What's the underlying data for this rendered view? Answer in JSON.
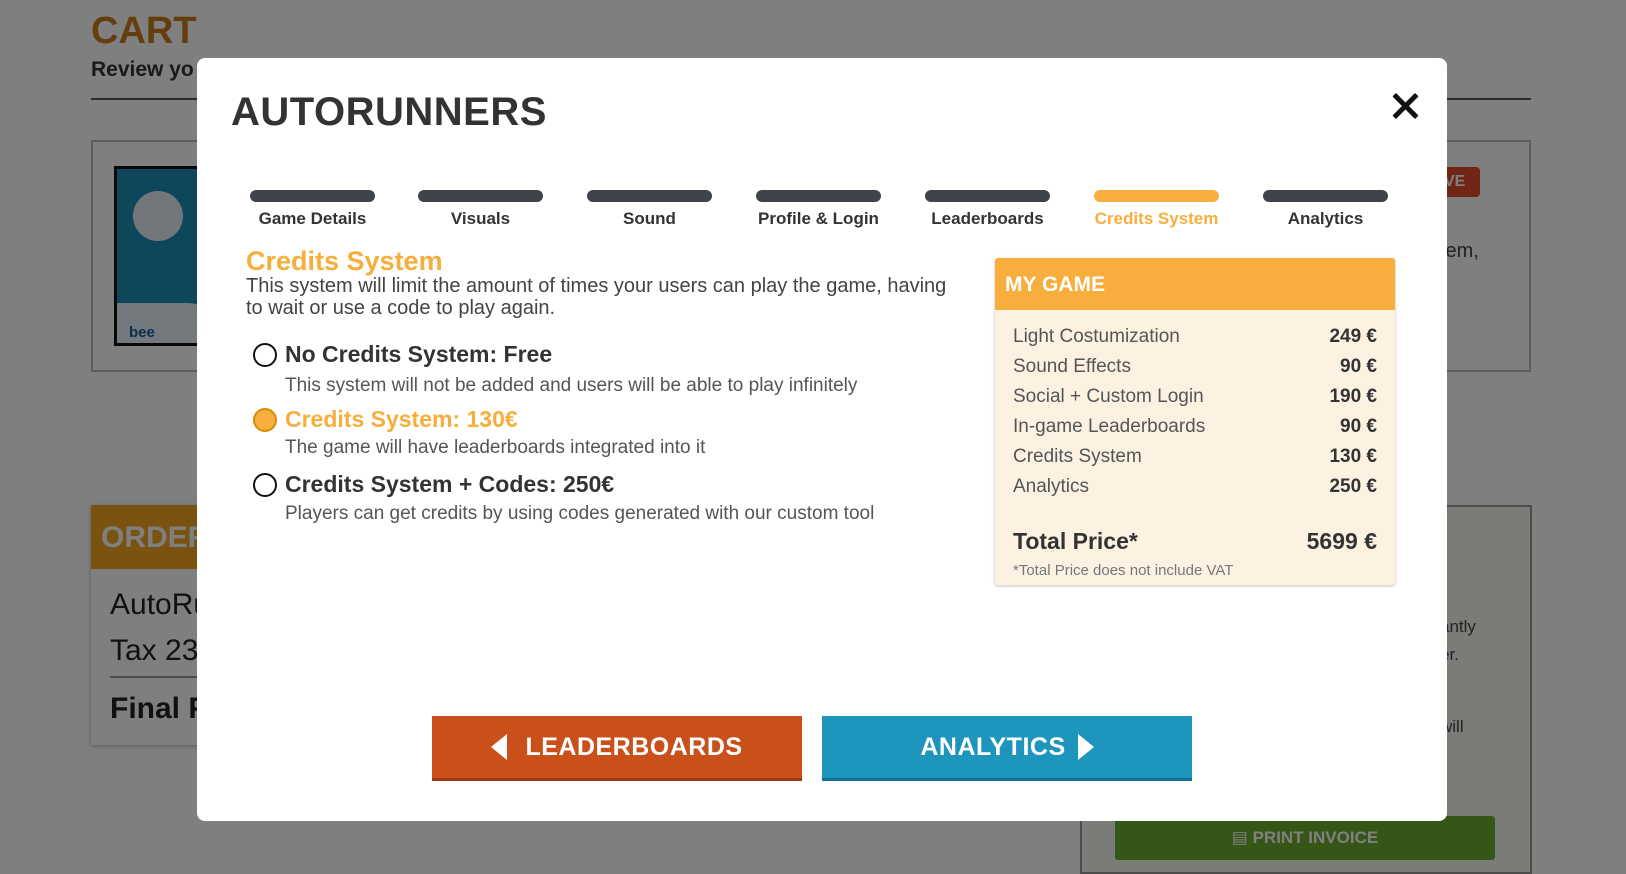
{
  "background": {
    "cart_title": "CART",
    "cart_subtitle": "Review yo",
    "thumb_brand": "bee",
    "badge_fragment": "VE",
    "right_fragment_1": "tem,",
    "order_title": "ORDER",
    "order_line_1": "AutoRu",
    "order_line_2": "Tax 23",
    "order_final": "Final P",
    "right_fragment_2": "antly",
    "right_fragment_3": "er.",
    "right_fragment_4": "will",
    "print_invoice": "PRINT INVOICE"
  },
  "modal": {
    "title": "AUTORUNNERS",
    "close_icon": "close-icon",
    "steps": [
      {
        "label": "Game Details",
        "active": false
      },
      {
        "label": "Visuals",
        "active": false
      },
      {
        "label": "Sound",
        "active": false
      },
      {
        "label": "Profile & Login",
        "active": false
      },
      {
        "label": "Leaderboards",
        "active": false
      },
      {
        "label": "Credits System",
        "active": true
      },
      {
        "label": "Analytics",
        "active": false
      }
    ],
    "section": {
      "title": "Credits System",
      "description": "This system will limit the amount of times your users can play the game, having to wait or use a code to play again."
    },
    "options": [
      {
        "label": "No Credits System: Free",
        "description": "This system will not be added and users will be able to play infinitely",
        "selected": false
      },
      {
        "label": "Credits System: 130€",
        "description": "The game will have leaderboards integrated into it",
        "selected": true
      },
      {
        "label": "Credits System + Codes: 250€",
        "description": "Players can get credits by using codes generated with our custom tool",
        "selected": false
      }
    ],
    "summary": {
      "title": "MY GAME",
      "items": [
        {
          "name": "Light Costumization",
          "price": "249 €"
        },
        {
          "name": "Sound Effects",
          "price": "90 €"
        },
        {
          "name": "Social + Custom Login",
          "price": "190 €"
        },
        {
          "name": "In-game Leaderboards",
          "price": "90 €"
        },
        {
          "name": "Credits System",
          "price": "130 €"
        },
        {
          "name": "Analytics",
          "price": "250 €"
        }
      ],
      "total_label": "Total Price*",
      "total_value": "5699 €",
      "note": "*Total Price does not include VAT"
    },
    "prev_button": "LEADERBOARDS",
    "next_button": "ANALYTICS"
  },
  "colors": {
    "accent": "#f8ae3c",
    "prev_button": "#c9501b",
    "next_button": "#1d95bd",
    "step_inactive": "#3f434a"
  }
}
